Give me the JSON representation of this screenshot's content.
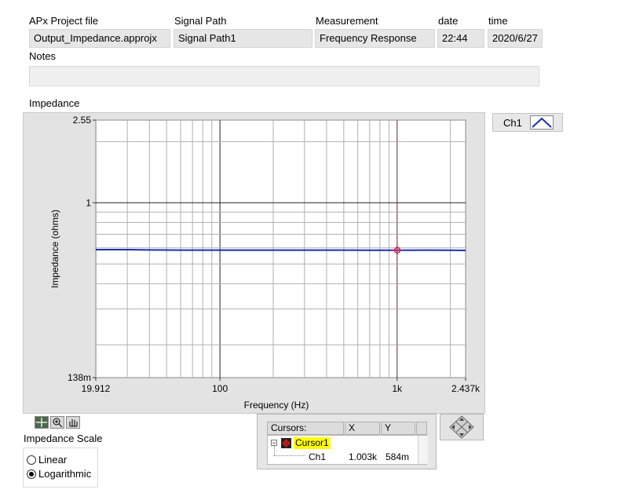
{
  "header": {
    "project_label": "APx Project file",
    "project_value": "Output_Impedance.approjx",
    "signal_path_label": "Signal Path",
    "signal_path_value": "Signal Path1",
    "measurement_label": "Measurement",
    "measurement_value": "Frequency Response",
    "date_label": "date",
    "date_value": "22:44",
    "time_label": "time",
    "time_value": "2020/6/27",
    "notes_label": "Notes",
    "notes_value": ""
  },
  "graph": {
    "title": "Impedance",
    "legend_channel": "Ch1",
    "plot_color": "#1c2fae",
    "cursor_color": "#d0204a"
  },
  "chart_data": {
    "type": "line",
    "title": "Impedance",
    "xlabel": "Frequency (Hz)",
    "ylabel": "Impedance (ohms)",
    "x_scale": "log",
    "y_scale": "log",
    "xlim": [
      19.912,
      2437
    ],
    "ylim": [
      0.138,
      2.55
    ],
    "x_tick_labels": [
      "19.912",
      "100",
      "1k",
      "2.437k"
    ],
    "y_tick_labels": [
      "2.55",
      "1",
      "138m"
    ],
    "grid": true,
    "series": [
      {
        "name": "Ch1",
        "x": [
          19.912,
          30,
          40,
          60,
          100,
          200,
          300,
          500,
          700,
          1003,
          1500,
          2000,
          2437
        ],
        "y": [
          0.588,
          0.588,
          0.586,
          0.585,
          0.585,
          0.585,
          0.585,
          0.585,
          0.584,
          0.584,
          0.585,
          0.584,
          0.583
        ]
      }
    ],
    "cursor": {
      "x": 1003,
      "y": 0.584
    }
  },
  "tools": [
    "cursor-tool",
    "zoom-tool",
    "pan-tool"
  ],
  "scale": {
    "label": "Impedance Scale",
    "options": [
      "Linear",
      "Logarithmic"
    ],
    "selected": "Logarithmic"
  },
  "cursors": {
    "header_label": "Cursors:",
    "col_x": "X",
    "col_y": "Y",
    "cursor_name": "Cursor1",
    "channel": "Ch1",
    "x_value": "1.003k",
    "y_value": "584m"
  }
}
